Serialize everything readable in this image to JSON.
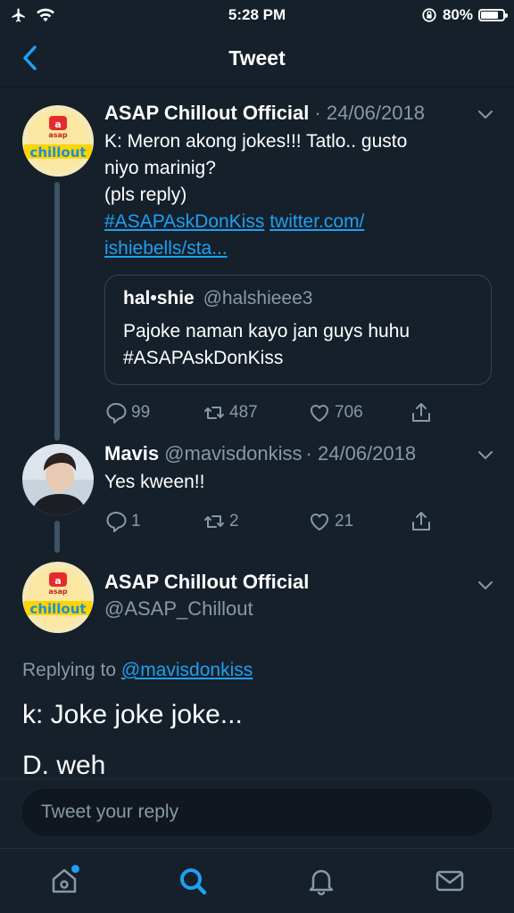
{
  "status_bar": {
    "time": "5:28 PM",
    "battery": "80%"
  },
  "nav": {
    "title": "Tweet"
  },
  "tweets": [
    {
      "name": "ASAP Chillout Official",
      "date": "24/06/2018",
      "avatar_text": "asap",
      "avatar_logo": "chillout",
      "lines": [
        "K: Meron akong jokes!!! Tatlo.. gusto",
        "niyo marinig?",
        "(pls reply)"
      ],
      "hashtag": "#ASAPAskDonKiss",
      "link1": "twitter.com/",
      "link2": "ishiebells/sta...",
      "quote": {
        "name": "hal•shie",
        "handle": "@halshieee3",
        "text1": "Pajoke naman kayo jan guys huhu",
        "text2": "#ASAPAskDonKiss"
      },
      "replies": "99",
      "retweets": "487",
      "likes": "706"
    },
    {
      "name": "Mavis",
      "handle": "@mavisdonkiss",
      "date": "24/06/2018",
      "text": "Yes kween!!",
      "replies": "1",
      "retweets": "2",
      "likes": "21"
    },
    {
      "name": "ASAP Chillout Official",
      "handle": "@ASAP_Chillout",
      "avatar_text": "asap",
      "avatar_logo": "chillout",
      "replying_label": "Replying to",
      "replying_to": "@mavisdonkiss",
      "line1": "k: Joke joke joke...",
      "line2": "D. weh"
    }
  ],
  "reply_box": {
    "placeholder": "Tweet your reply"
  },
  "tabs": [
    "home-icon",
    "search-icon",
    "notifications-icon",
    "messages-icon"
  ],
  "colors": {
    "bg": "#15202b",
    "accent": "#1da1f2",
    "muted": "#8899a6"
  }
}
